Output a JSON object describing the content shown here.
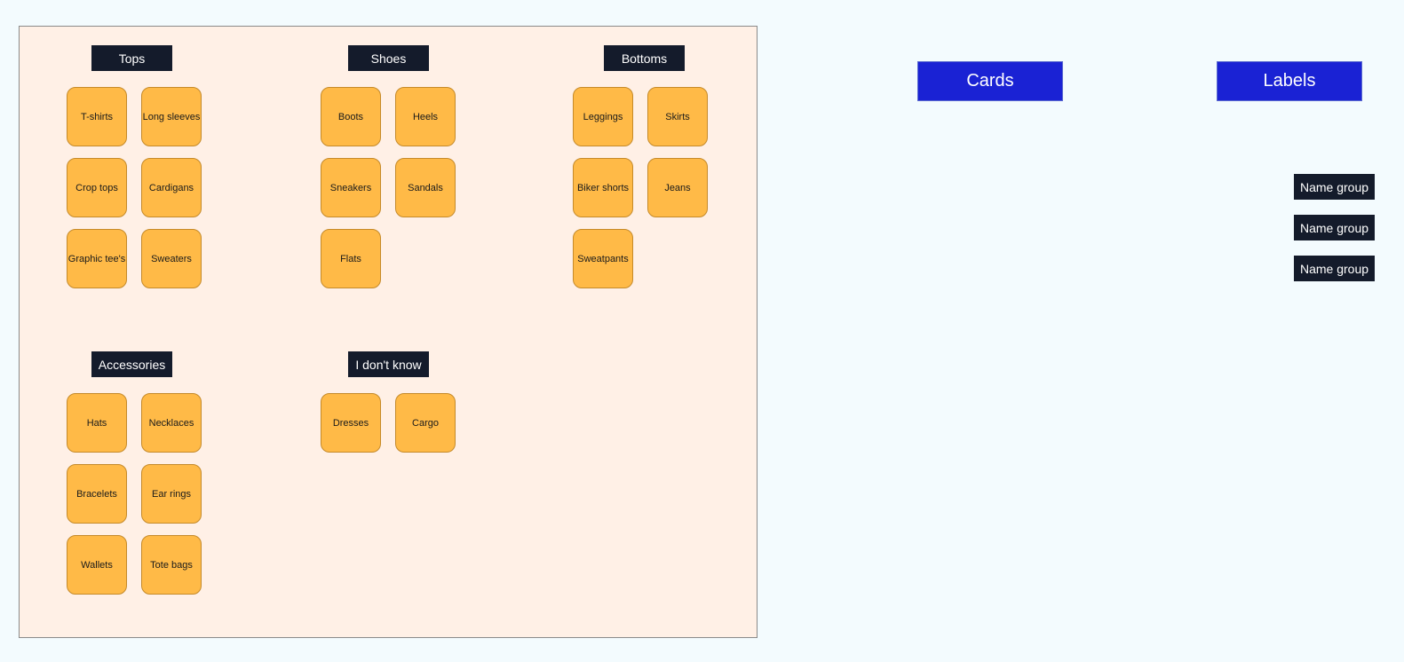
{
  "groups": [
    {
      "label": "Tops",
      "cards": [
        "T-shirts",
        "Long sleeves",
        "Crop tops",
        "Cardigans",
        "Graphic tee's",
        "Sweaters"
      ]
    },
    {
      "label": "Shoes",
      "cards": [
        "Boots",
        "Heels",
        "Sneakers",
        "Sandals",
        "Flats"
      ]
    },
    {
      "label": "Bottoms",
      "cards": [
        "Leggings",
        "Skirts",
        "Biker shorts",
        "Jeans",
        "Sweatpants"
      ]
    },
    {
      "label": "Accessories",
      "cards": [
        "Hats",
        "Necklaces",
        "Bracelets",
        "Ear rings",
        "Wallets",
        "Tote bags"
      ]
    },
    {
      "label": "I don't know",
      "cards": [
        "Dresses",
        "Cargo"
      ]
    }
  ],
  "headers": {
    "cards": "Cards",
    "labels": "Labels"
  },
  "name_groups": [
    "Name group",
    "Name group",
    "Name group"
  ],
  "colors": {
    "background": "#f3fbfe",
    "board": "#fff0e6",
    "card": "#ffba47",
    "label_dark": "#141b2b",
    "header_blue": "#1a22d4"
  }
}
